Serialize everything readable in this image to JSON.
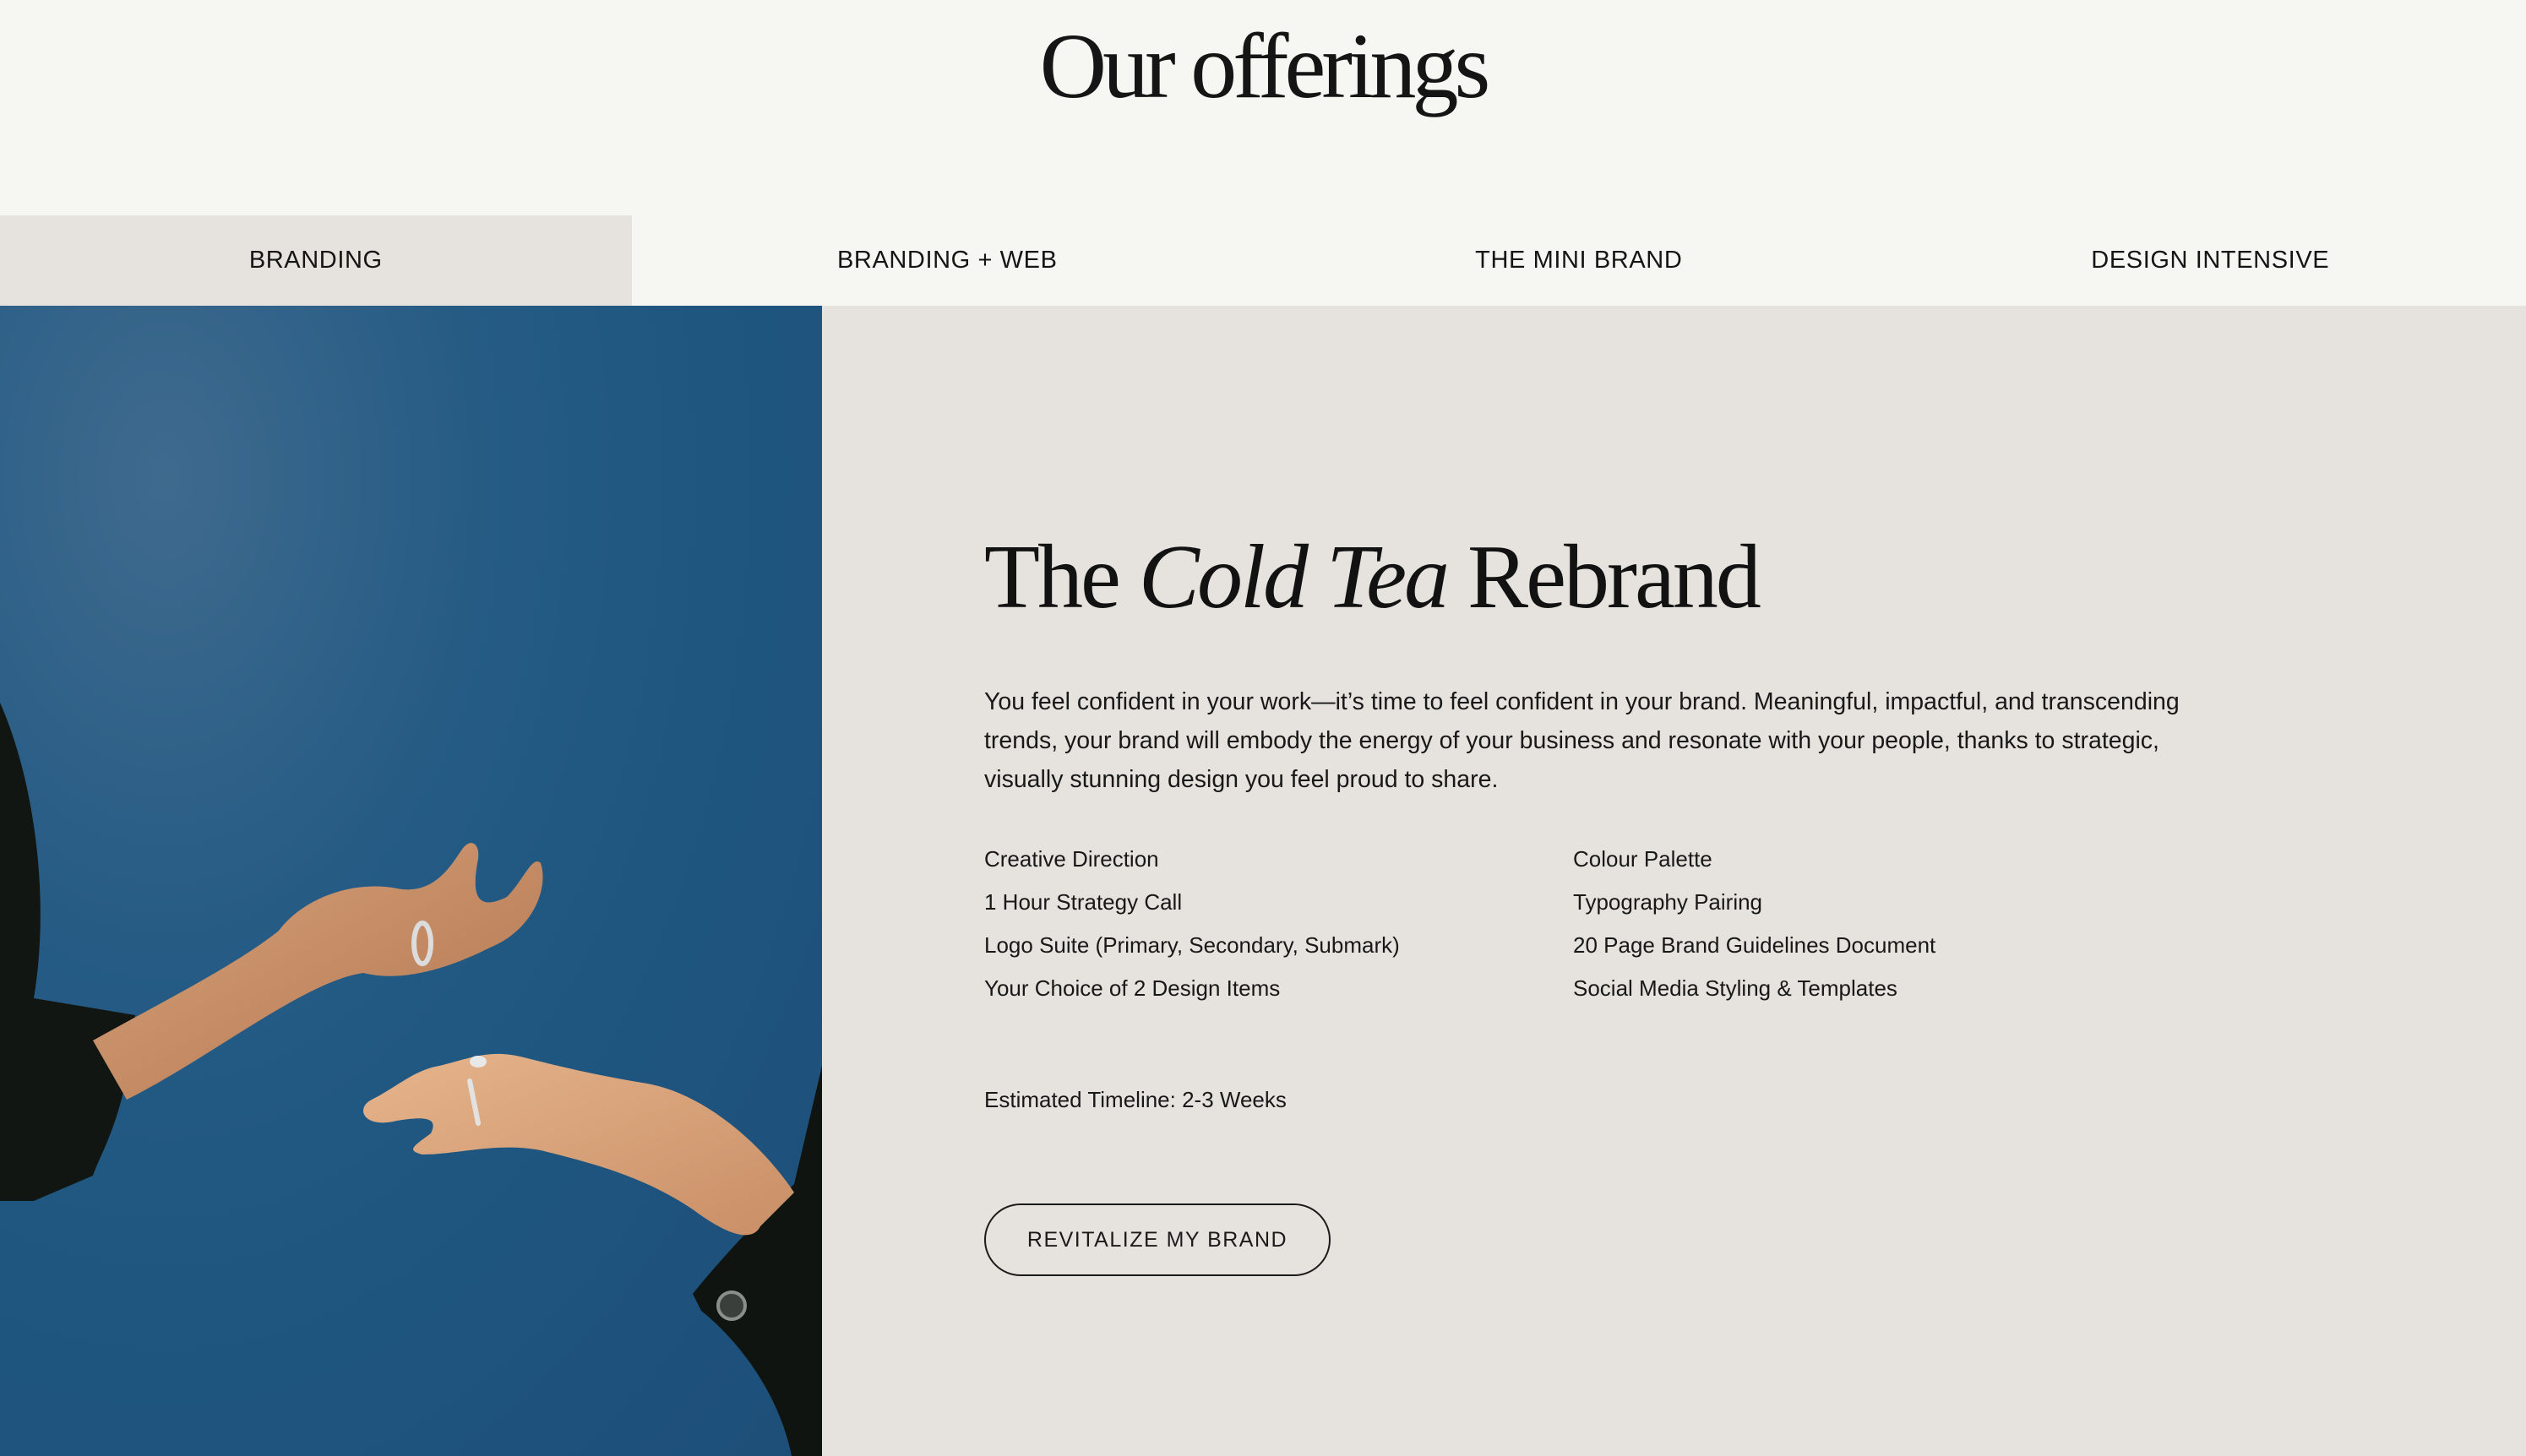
{
  "page": {
    "title": "Our offerings"
  },
  "tabs": [
    {
      "label": "BRANDING",
      "active": true
    },
    {
      "label": "BRANDING + WEB",
      "active": false
    },
    {
      "label": "THE MINI BRAND",
      "active": false
    },
    {
      "label": "DESIGN INTENSIVE",
      "active": false
    }
  ],
  "offering": {
    "heading_pre": "The ",
    "heading_italic": "Cold Tea",
    "heading_post": " Rebrand",
    "description": "You feel confident in your work—it’s time to feel confident in your brand. Meaningful, impactful, and transcending trends, your brand will embody the energy of your business and resonate with your people, thanks to strategic, visually stunning design you feel proud to share.",
    "features_left": [
      "Creative Direction",
      "1 Hour Strategy Call",
      "Logo Suite (Primary, Secondary, Submark)",
      "Your Choice of 2 Design Items"
    ],
    "features_right": [
      "Colour Palette",
      "Typography Pairing",
      "20 Page Brand Guidelines Document",
      "Social Media Styling & Templates"
    ],
    "timeline": "Estimated Timeline: 2-3 Weeks",
    "cta_label": "REVITALIZE MY BRAND"
  },
  "colors": {
    "page_background": "#f6f6f2",
    "panel_background": "#e6e3de",
    "photo_background": "#1f5580",
    "text": "#151515"
  },
  "photo": {
    "description_icon": "hands-photo"
  }
}
